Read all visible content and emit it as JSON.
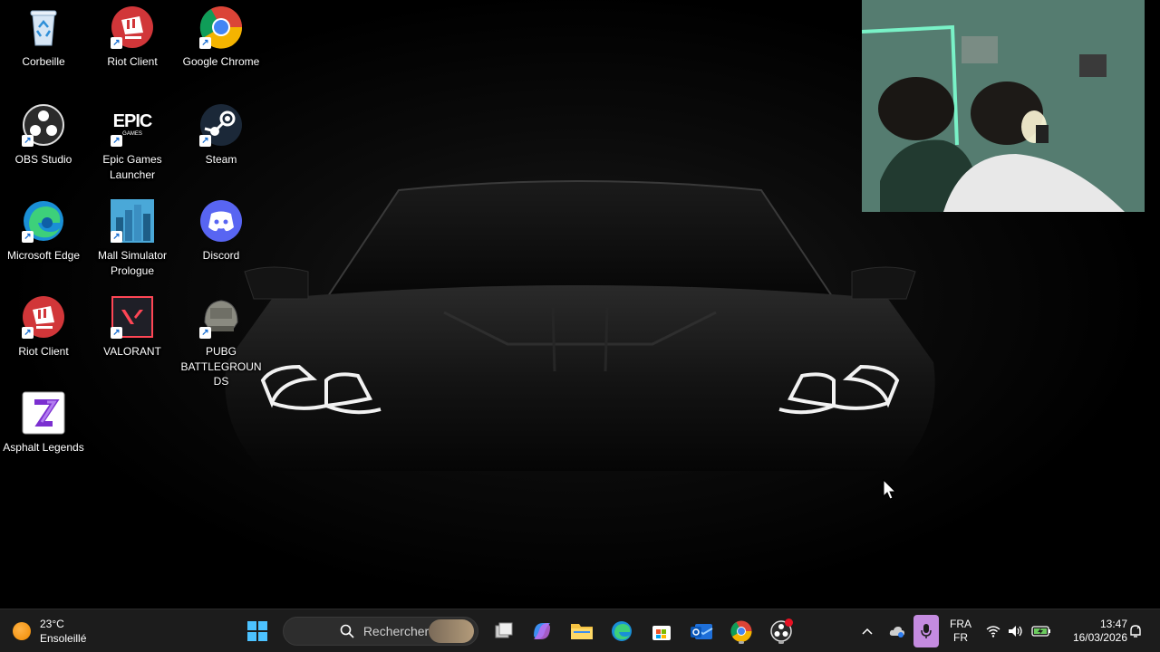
{
  "desktop": {
    "icons": [
      {
        "id": "recycle-bin",
        "label": "Corbeille",
        "icon": "recycle-bin-icon",
        "shortcut": false
      },
      {
        "id": "riot-client-1",
        "label": "Riot Client",
        "icon": "riot-client-icon",
        "shortcut": true
      },
      {
        "id": "google-chrome",
        "label": "Google Chrome",
        "icon": "chrome-icon",
        "shortcut": true
      },
      {
        "id": "obs-studio",
        "label": "OBS Studio",
        "icon": "obs-icon",
        "shortcut": true
      },
      {
        "id": "epic-games",
        "label": "Epic Games Launcher",
        "icon": "epic-games-icon",
        "shortcut": true
      },
      {
        "id": "steam",
        "label": "Steam",
        "icon": "steam-icon",
        "shortcut": true
      },
      {
        "id": "microsoft-edge",
        "label": "Microsoft Edge",
        "icon": "edge-icon",
        "shortcut": true
      },
      {
        "id": "mall-simulator",
        "label": "Mall Simulator Prologue",
        "icon": "mall-simulator-icon",
        "shortcut": true
      },
      {
        "id": "discord",
        "label": "Discord",
        "icon": "discord-icon",
        "shortcut": true
      },
      {
        "id": "riot-client-2",
        "label": "Riot Client",
        "icon": "riot-client-icon",
        "shortcut": true
      },
      {
        "id": "valorant",
        "label": "VALORANT",
        "icon": "valorant-icon",
        "shortcut": true
      },
      {
        "id": "pubg",
        "label": "PUBG BATTLEGROUNDS",
        "icon": "pubg-icon",
        "shortcut": true
      },
      {
        "id": "asphalt",
        "label": "Asphalt Legends",
        "icon": "asphalt-icon",
        "shortcut": false
      }
    ],
    "epic_logo_text": "EPIC",
    "epic_logo_sub": "GAMES"
  },
  "webcam": {
    "icon": "webcam-feed"
  },
  "taskbar": {
    "weather": {
      "temp": "23°C",
      "condition": "Ensoleillé",
      "icon": "sun-icon"
    },
    "search": {
      "placeholder": "Rechercher"
    },
    "pinned": [
      {
        "id": "start",
        "icon": "windows-start-icon"
      },
      {
        "id": "task-view",
        "icon": "task-view-icon"
      },
      {
        "id": "copilot-m365",
        "icon": "m365-copilot-icon",
        "badge": "M365"
      },
      {
        "id": "file-explorer",
        "icon": "folder-icon"
      },
      {
        "id": "edge",
        "icon": "edge-icon"
      },
      {
        "id": "store",
        "icon": "microsoft-store-icon"
      },
      {
        "id": "outlook",
        "icon": "outlook-icon"
      },
      {
        "id": "chrome",
        "icon": "chrome-icon"
      },
      {
        "id": "obs",
        "icon": "obs-icon"
      }
    ],
    "tray": {
      "language_line1": "FRA",
      "language_line2": "FR",
      "time": "13:47",
      "date": "16/03/2026"
    },
    "colors": {
      "taskbar_bg": "#1c1c1c",
      "mic_active": "#c48be0",
      "accent": "#0a84ff"
    }
  }
}
